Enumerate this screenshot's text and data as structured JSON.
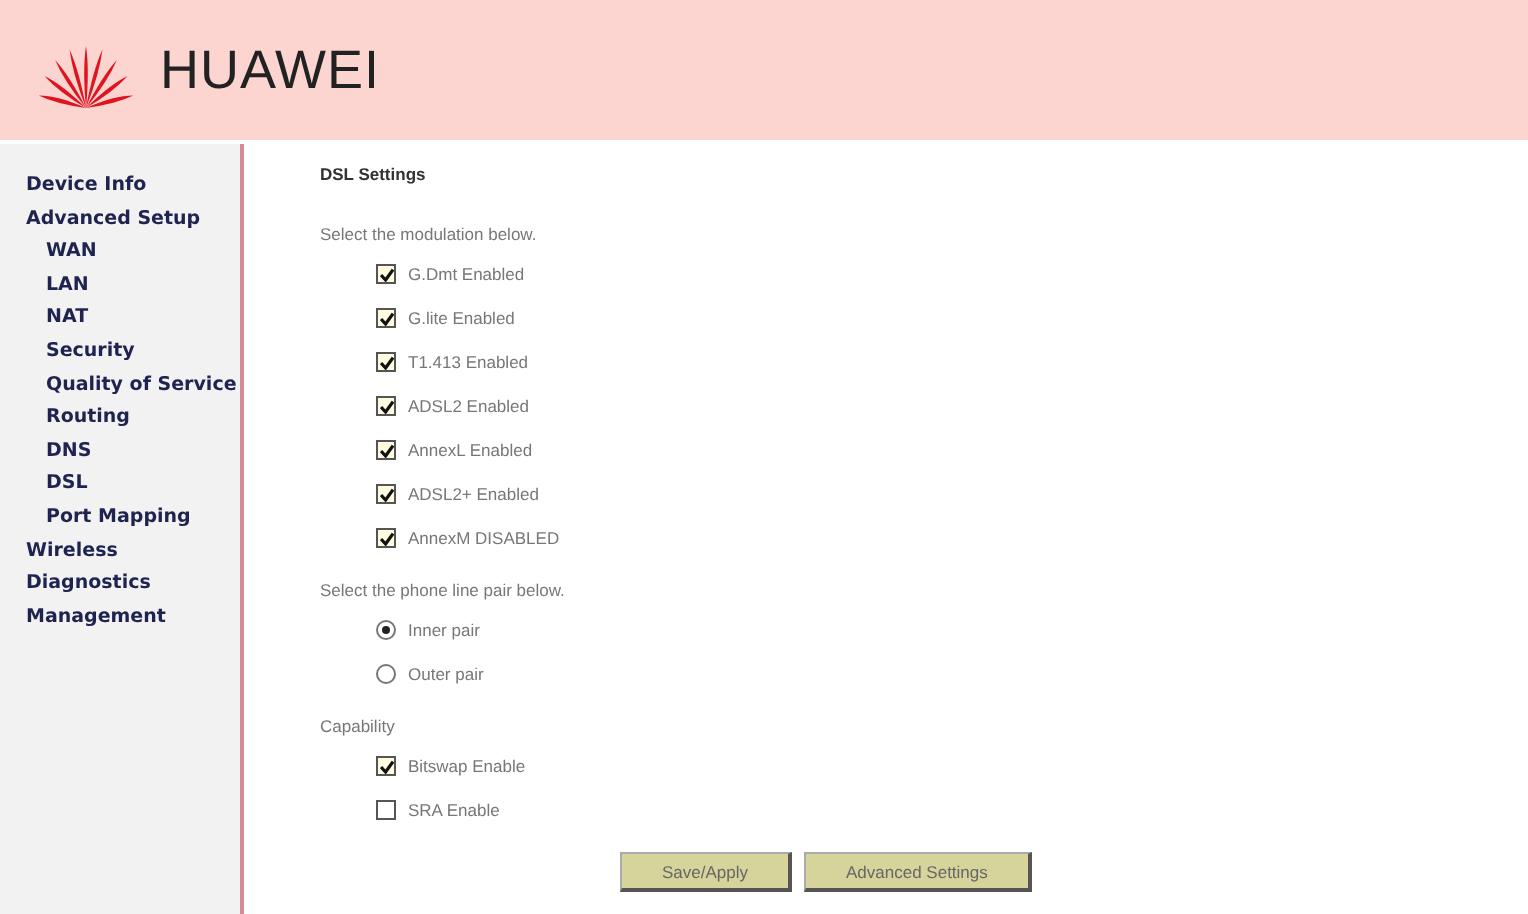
{
  "header": {
    "brand": "HUAWEI"
  },
  "sidebar": {
    "items": [
      {
        "label": "Device Info"
      },
      {
        "label": "Advanced Setup",
        "children": [
          {
            "label": "WAN"
          },
          {
            "label": "LAN"
          },
          {
            "label": "NAT"
          },
          {
            "label": "Security"
          },
          {
            "label": "Quality of Service"
          },
          {
            "label": "Routing"
          },
          {
            "label": "DNS"
          },
          {
            "label": "DSL"
          },
          {
            "label": "Port Mapping"
          }
        ]
      },
      {
        "label": "Wireless"
      },
      {
        "label": "Diagnostics"
      },
      {
        "label": "Management"
      }
    ]
  },
  "content": {
    "title": "DSL Settings",
    "sections": [
      {
        "label": "Select the modulation below.",
        "kind": "checkbox",
        "options": [
          {
            "label": "G.Dmt Enabled",
            "checked": true
          },
          {
            "label": "G.lite Enabled",
            "checked": true
          },
          {
            "label": "T1.413 Enabled",
            "checked": true
          },
          {
            "label": "ADSL2 Enabled",
            "checked": true
          },
          {
            "label": "AnnexL Enabled",
            "checked": true
          },
          {
            "label": "ADSL2+ Enabled",
            "checked": true
          },
          {
            "label": "AnnexM DISABLED",
            "checked": true
          }
        ]
      },
      {
        "label": "Select the phone line pair below.",
        "kind": "radio",
        "options": [
          {
            "label": "Inner pair",
            "selected": true
          },
          {
            "label": "Outer pair",
            "selected": false
          }
        ]
      },
      {
        "label": "Capability",
        "kind": "checkbox",
        "options": [
          {
            "label": "Bitswap Enable",
            "checked": true
          },
          {
            "label": "SRA Enable",
            "checked": false
          }
        ]
      }
    ],
    "buttons": [
      "Save/Apply",
      "Advanced Settings"
    ]
  }
}
